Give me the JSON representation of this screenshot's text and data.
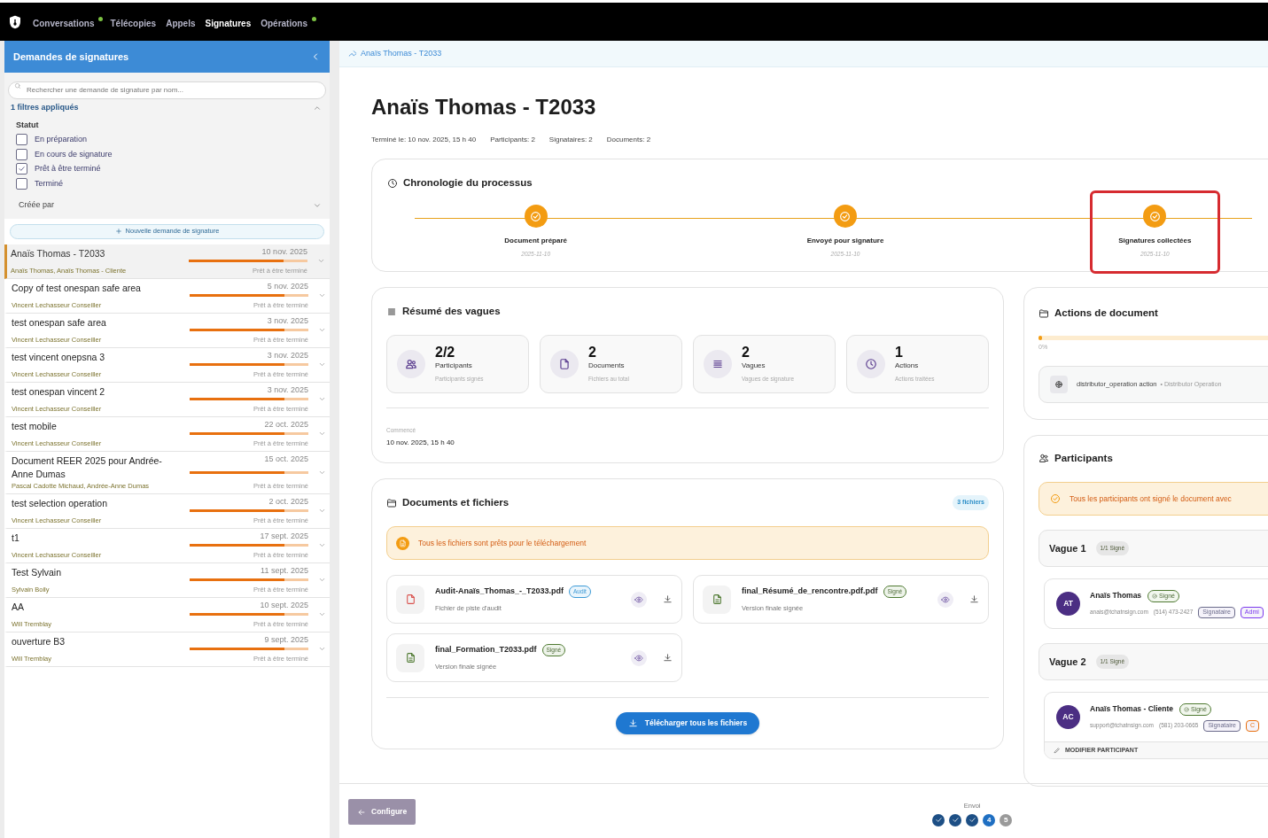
{
  "nav": {
    "items": [
      {
        "label": "Conversations",
        "selected": false,
        "dot": true
      },
      {
        "label": "Télécopies",
        "selected": false,
        "dot": false
      },
      {
        "label": "Appels",
        "selected": false,
        "dot": false
      },
      {
        "label": "Signatures",
        "selected": true,
        "dot": false
      },
      {
        "label": "Opérations",
        "selected": false,
        "dot": true
      }
    ]
  },
  "sidebar": {
    "title": "Demandes de signatures",
    "search_placeholder": "Rechercher une demande de signature par nom...",
    "filters_label": "1 filtres appliqués",
    "filter_group": "Statut",
    "filters": [
      {
        "label": "En préparation",
        "checked": false
      },
      {
        "label": "En cours de signature",
        "checked": false
      },
      {
        "label": "Prêt à être terminé",
        "checked": true
      },
      {
        "label": "Terminé",
        "checked": false
      }
    ],
    "created_by": "Créée par",
    "new_button": "Nouvelle demande de signature",
    "requests": [
      {
        "title": "Anaïs Thomas - T2033",
        "date": "10 nov. 2025",
        "subtitle": "Anaïs Thomas, Anaïs Thomas - Cliente",
        "status": "Prêt à être terminé",
        "level": 0.8,
        "selected": true
      },
      {
        "title": "Copy of test onespan safe area",
        "date": "5 nov. 2025",
        "subtitle": "Vincent Lechasseur Conseiller",
        "status": "Prêt à être terminé",
        "level": 0.8,
        "selected": false
      },
      {
        "title": "test onespan safe area",
        "date": "3 nov. 2025",
        "subtitle": "Vincent Lechasseur Conseiller",
        "status": "Prêt à être terminé",
        "level": 0.8,
        "selected": false
      },
      {
        "title": "test vincent onepsna 3",
        "date": "3 nov. 2025",
        "subtitle": "Vincent Lechasseur Conseiller",
        "status": "Prêt à être terminé",
        "level": 0.8,
        "selected": false
      },
      {
        "title": "test onespan vincent 2",
        "date": "3 nov. 2025",
        "subtitle": "Vincent Lechasseur Conseiller",
        "status": "Prêt à être terminé",
        "level": 0.8,
        "selected": false
      },
      {
        "title": "test mobile",
        "date": "22 oct. 2025",
        "subtitle": "Vincent Lechasseur Conseiller",
        "status": "Prêt à être terminé",
        "level": 0.8,
        "selected": false
      },
      {
        "title": "Document REER 2025 pour Andrée-Anne Dumas",
        "date": "15 oct. 2025",
        "subtitle": "Pascal Cadotte Michaud, Andrée-Anne Dumas",
        "status": "Prêt à être terminé",
        "level": 0.8,
        "selected": false
      },
      {
        "title": "test selection operation",
        "date": "2 oct. 2025",
        "subtitle": "Vincent Lechasseur Conseiller",
        "status": "Prêt à être terminé",
        "level": 0.8,
        "selected": false
      },
      {
        "title": "t1",
        "date": "17 sept. 2025",
        "subtitle": "Vincent Lechasseur Conseiller",
        "status": "Prêt à être terminé",
        "level": 0.8,
        "selected": false
      },
      {
        "title": "Test Sylvain",
        "date": "11 sept. 2025",
        "subtitle": "Sylvain Boily",
        "status": "Prêt à être terminé",
        "level": 0.8,
        "selected": false
      },
      {
        "title": "AA",
        "date": "10 sept. 2025",
        "subtitle": "Will Tremblay",
        "status": "Prêt à être terminé",
        "level": 0.8,
        "selected": false
      },
      {
        "title": "ouverture B3",
        "date": "9 sept. 2025",
        "subtitle": "Will Tremblay",
        "status": "Prêt à être terminé",
        "level": 0.8,
        "selected": false
      }
    ]
  },
  "breadcrumb": "Anaïs Thomas - T2033",
  "title": "Anaïs Thomas - T2033",
  "meta": [
    "Terminé le: 10 nov. 2025, 15 h 40",
    "Participants: 2",
    "Signataires: 2",
    "Documents: 2"
  ],
  "timeline": {
    "title": "Chronologie du processus",
    "steps": [
      {
        "label": "Document préparé",
        "date": "2025-11-10",
        "done": true,
        "highlighted": false
      },
      {
        "label": "Envoyé pour signature",
        "date": "2025-11-10",
        "done": true,
        "highlighted": false
      },
      {
        "label": "Signatures collectées",
        "date": "2025-11-10",
        "done": true,
        "highlighted": true
      }
    ]
  },
  "summary": {
    "title": "Résumé des vagues",
    "stats": [
      {
        "kind": "participants",
        "value": "2/2",
        "label": "Participants",
        "caption": "Participants signés"
      },
      {
        "kind": "documents",
        "value": "2",
        "label": "Documents",
        "caption": "Fichiers au total"
      },
      {
        "kind": "waves",
        "value": "2",
        "label": "Vagues",
        "caption": "Vagues de signature"
      },
      {
        "kind": "actions",
        "value": "1",
        "label": "Actions",
        "caption": "Actions traitées"
      }
    ],
    "started_label": "Commencé",
    "started_value": "10 nov. 2025, 15 h 40"
  },
  "documents": {
    "title": "Documents et fichiers",
    "count": "3 fichiers",
    "notice": "Tous les fichiers sont prêts pour le téléchargement",
    "files": [
      {
        "kind": "audit",
        "name": "Audit-Anaïs_Thomas_-_T2033.pdf",
        "badge": "Audit",
        "description": "Fichier de piste d'audit"
      },
      {
        "kind": "signed",
        "name": "final_Résumé_de_rencontre.pdf.pdf",
        "badge": "Signé",
        "description": "Version finale signée"
      },
      {
        "kind": "signed",
        "name": "final_Formation_T2033.pdf",
        "badge": "Signé",
        "description": "Version finale signée"
      }
    ],
    "download_all": "Télécharger tous les fichiers"
  },
  "actions": {
    "title": "Actions de document",
    "level": 0,
    "percent": "0%",
    "items": [
      {
        "name": "distributor_operation action",
        "type": "• Distributor Operation"
      }
    ]
  },
  "participants": {
    "title": "Participants",
    "notice": "Tous les participants ont signé le document avec",
    "waves": [
      {
        "title": "Vague 1",
        "badge": "1/1 Signé",
        "members": [
          {
            "initials": "AT",
            "name": "Anaïs Thomas",
            "status": "Signé",
            "email": "anais@tchatnsign.com",
            "phone": "(514) 473-2427",
            "roles": [
              {
                "label": "Signataire",
                "color": "#6b6b8a"
              },
              {
                "label": "Admi",
                "color": "#7c3aed"
              }
            ]
          }
        ]
      },
      {
        "title": "Vague 2",
        "badge": "1/1 Signé",
        "members": [
          {
            "initials": "AC",
            "name": "Anaïs Thomas - Cliente",
            "status": "Signé",
            "email": "support@tchatnsign.com",
            "phone": "(581) 203-0665",
            "roles": [
              {
                "label": "Signataire",
                "color": "#6b6b8a"
              },
              {
                "label": "C",
                "color": "#e8700f"
              }
            ],
            "edit": "MODIFIER PARTICIPANT"
          }
        ]
      }
    ]
  },
  "footer": {
    "back_button": "Configure",
    "stepper_label": "Envoi",
    "steps": [
      {
        "done": true
      },
      {
        "done": true
      },
      {
        "done": true
      },
      {
        "done": false,
        "current": true,
        "label": "4"
      },
      {
        "done": false,
        "current": false,
        "label": "5"
      }
    ]
  }
}
